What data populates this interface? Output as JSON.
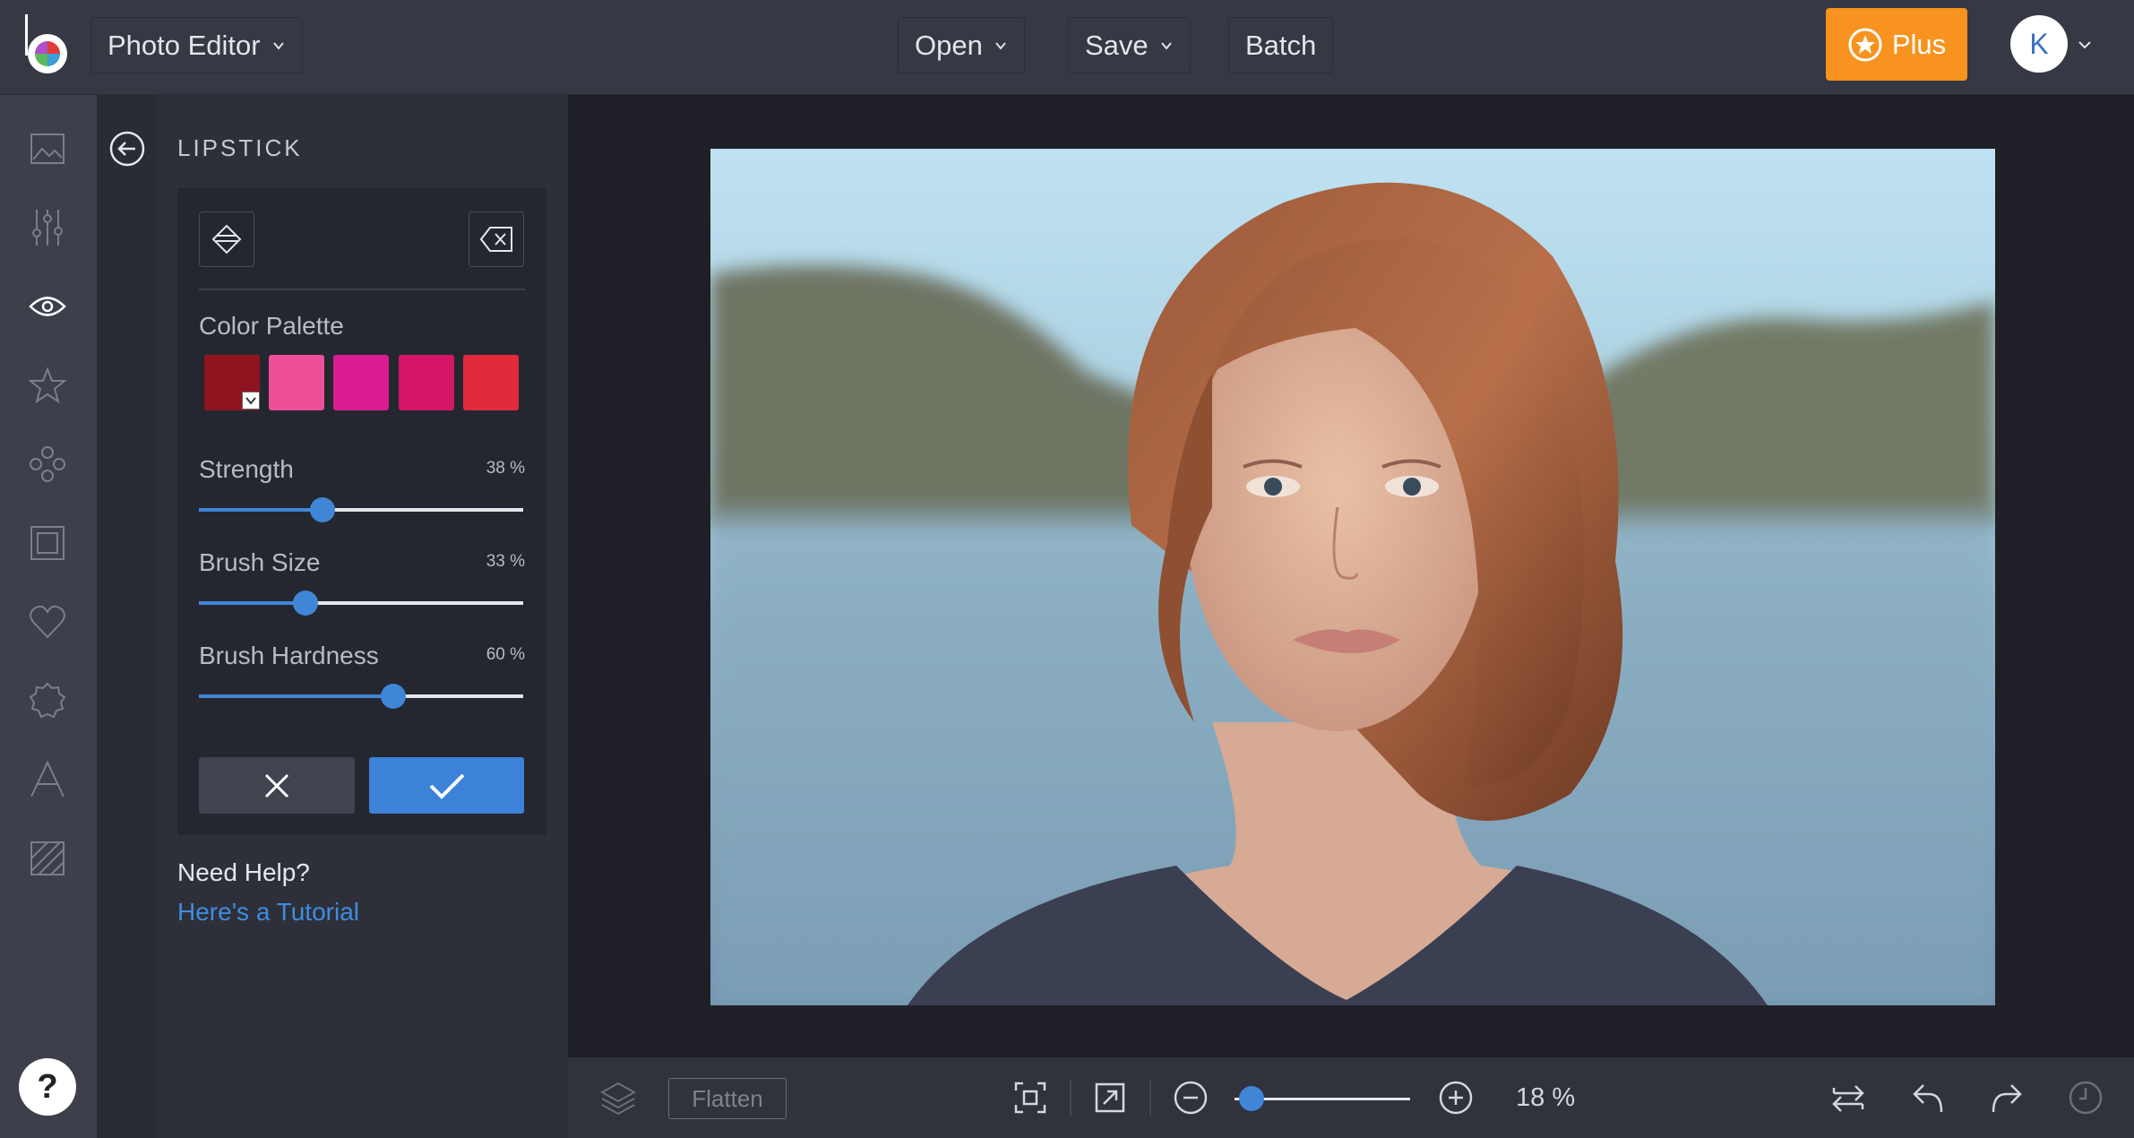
{
  "header": {
    "app_menu_label": "Photo Editor",
    "open_label": "Open",
    "save_label": "Save",
    "batch_label": "Batch",
    "plus_label": "Plus",
    "avatar_initial": "K"
  },
  "rail": {
    "items": [
      "image-icon",
      "sliders-icon",
      "eye-icon",
      "star-icon",
      "shapes-icon",
      "frame-icon",
      "heart-icon",
      "badge-icon",
      "text-icon",
      "texture-icon"
    ],
    "active": "eye-icon",
    "help_label": "?"
  },
  "panel": {
    "title": "LIPSTICK",
    "color_palette_label": "Color Palette",
    "swatches": [
      "#8e1520",
      "#ee4f98",
      "#d91c93",
      "#d51565",
      "#e22a3d"
    ],
    "selected_swatch": 0,
    "sliders": [
      {
        "label": "Strength",
        "value_text": "38 %",
        "value": 38
      },
      {
        "label": "Brush Size",
        "value_text": "33 %",
        "value": 33
      },
      {
        "label": "Brush Hardness",
        "value_text": "60 %",
        "value": 60
      }
    ],
    "help_title": "Need Help?",
    "help_link": "Here's a Tutorial"
  },
  "bottombar": {
    "flatten_label": "Flatten",
    "zoom_text": "18 %",
    "zoom_value": 18
  },
  "colors": {
    "accent": "#3f86d6",
    "plus": "#f7931e",
    "link": "#3f8ce0"
  }
}
